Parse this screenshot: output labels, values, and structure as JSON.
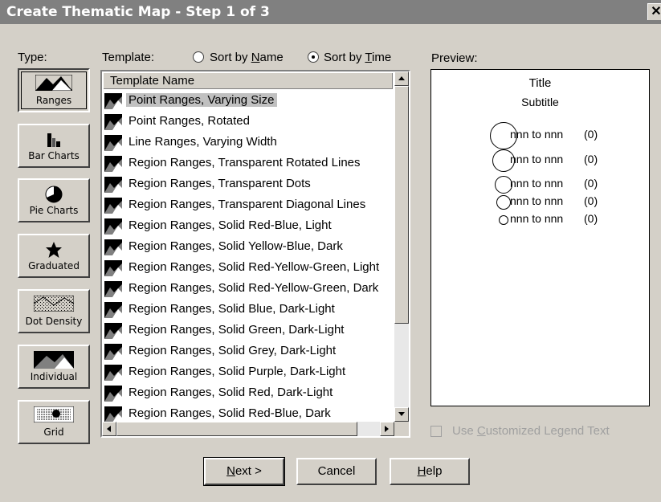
{
  "window": {
    "title": "Create Thematic Map - Step 1 of 3",
    "close_glyph": "✕"
  },
  "type_section": {
    "label": "Type:",
    "buttons": [
      {
        "label": "Ranges",
        "icon": "ranges-map-icon",
        "selected": true
      },
      {
        "label": "Bar Charts",
        "icon": "bar-chart-icon",
        "selected": false
      },
      {
        "label": "Pie Charts",
        "icon": "pie-chart-icon",
        "selected": false
      },
      {
        "label": "Graduated",
        "icon": "graduated-star-icon",
        "selected": false
      },
      {
        "label": "Dot Density",
        "icon": "dot-density-icon",
        "selected": false
      },
      {
        "label": "Individual",
        "icon": "individual-map-icon",
        "selected": false
      },
      {
        "label": "Grid",
        "icon": "grid-map-icon",
        "selected": false
      }
    ]
  },
  "template_section": {
    "label": "Template:",
    "sort_by_name_prefix": "Sort by ",
    "sort_by_name_key": "N",
    "sort_by_name_rest": "ame",
    "sort_by_name_selected": false,
    "sort_by_time_prefix": "Sort by ",
    "sort_by_time_key": "T",
    "sort_by_time_rest": "ime",
    "sort_by_time_selected": true,
    "column_header": "Template Name",
    "items": [
      "Point Ranges, Varying Size",
      "Point Ranges, Rotated",
      "Line Ranges, Varying Width",
      "Region Ranges, Transparent Rotated Lines",
      "Region Ranges, Transparent Dots",
      "Region Ranges, Transparent Diagonal Lines",
      "Region Ranges, Solid Red-Blue, Light",
      "Region Ranges, Solid Yellow-Blue, Dark",
      "Region Ranges, Solid Red-Yellow-Green, Light",
      "Region Ranges, Solid Red-Yellow-Green, Dark",
      "Region Ranges, Solid Blue, Dark-Light",
      "Region Ranges, Solid Green, Dark-Light",
      "Region Ranges, Solid Grey, Dark-Light",
      "Region Ranges, Solid Purple, Dark-Light",
      "Region Ranges, Solid Red, Dark-Light",
      "Region Ranges, Solid Red-Blue, Dark"
    ],
    "selected_index": 0
  },
  "preview": {
    "label": "Preview:",
    "title": "Title",
    "subtitle": "Subtitle",
    "legend": [
      {
        "text": "nnn to nnn",
        "count": "(0)"
      },
      {
        "text": "nnn to nnn",
        "count": "(0)"
      },
      {
        "text": "nnn to nnn",
        "count": "(0)"
      },
      {
        "text": "nnn to nnn",
        "count": "(0)"
      },
      {
        "text": "nnn to nnn",
        "count": "(0)"
      }
    ]
  },
  "custom_legend": {
    "prefix": "Use ",
    "key": "C",
    "rest": "ustomized Legend Text",
    "checked": false,
    "enabled": false
  },
  "buttons": {
    "next_key": "N",
    "next_rest": "ext >",
    "cancel": "Cancel",
    "help_key": "H",
    "help_rest": "elp"
  },
  "colors": {
    "titlebar": "#808080",
    "face": "#d4d0c8",
    "selection": "#c0c0c0"
  }
}
